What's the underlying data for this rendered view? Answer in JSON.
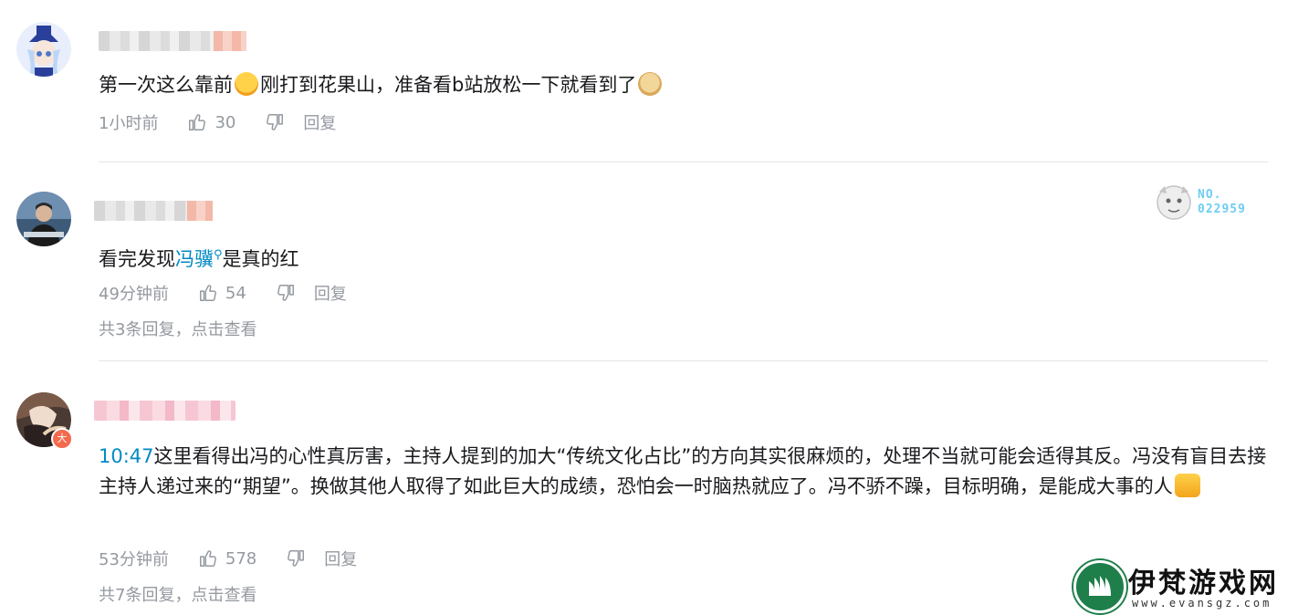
{
  "comments": [
    {
      "text_parts": [
        "第一次这么靠前",
        "刚打到花果山，准备看b站放松一下就看到了"
      ],
      "emojis": [
        "shocked-face-emoji",
        "doge-emoji"
      ],
      "time": "1小时前",
      "likes": "30",
      "reply_label": "回复"
    },
    {
      "text_before": "看完发现",
      "link": "冯骥",
      "text_after": "是真的红",
      "time": "49分钟前",
      "likes": "54",
      "reply_label": "回复",
      "replies_summary": "共3条回复，点击查看",
      "badge": {
        "line1": "NO.",
        "line2": "022959"
      }
    },
    {
      "timestamp_link": "10:47",
      "text": "这里看得出冯的心性真厉害，主持人提到的加大“传统文化占比”的方向其实很麻烦的，处理不当就可能会适得其反。冯没有盲目去接主持人递过来的“期望”。换做其他人取得了如此巨大的成绩，恐怕会一时脑热就应了。冯不骄不躁，目标明确，是能成大事的人",
      "emoji": "thumbs-up-emoji",
      "time": "53分钟前",
      "likes": "578",
      "reply_label": "回复",
      "replies_summary": "共7条回复，点击查看",
      "level_badge": "大"
    }
  ],
  "watermark": {
    "brand": "伊梵游戏网",
    "site": "www.evansgz.com"
  },
  "colors": {
    "link": "#008ac5",
    "meta": "#9499a0",
    "divider": "#e3e5e7",
    "text": "#18191c"
  }
}
